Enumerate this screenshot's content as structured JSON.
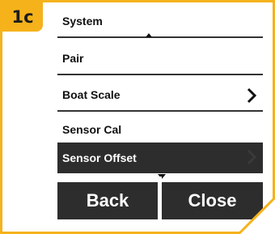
{
  "step_badge": "1c",
  "colors": {
    "accent": "#f5b21b",
    "selected_bg": "#2d2d2d",
    "text": "#111111"
  },
  "menu": {
    "items": [
      {
        "label": "System"
      },
      {
        "label": "Pair"
      },
      {
        "label": "Boat Scale",
        "icon": "chevron-right-icon"
      },
      {
        "label": "Sensor Cal"
      },
      {
        "label": "Sensor Offset",
        "icon": "chevron-right-icon",
        "selected": true
      }
    ],
    "scroll_up_icon": "scroll-up-icon",
    "scroll_down_icon": "scroll-down-icon"
  },
  "buttons": {
    "back": "Back",
    "close": "Close"
  }
}
